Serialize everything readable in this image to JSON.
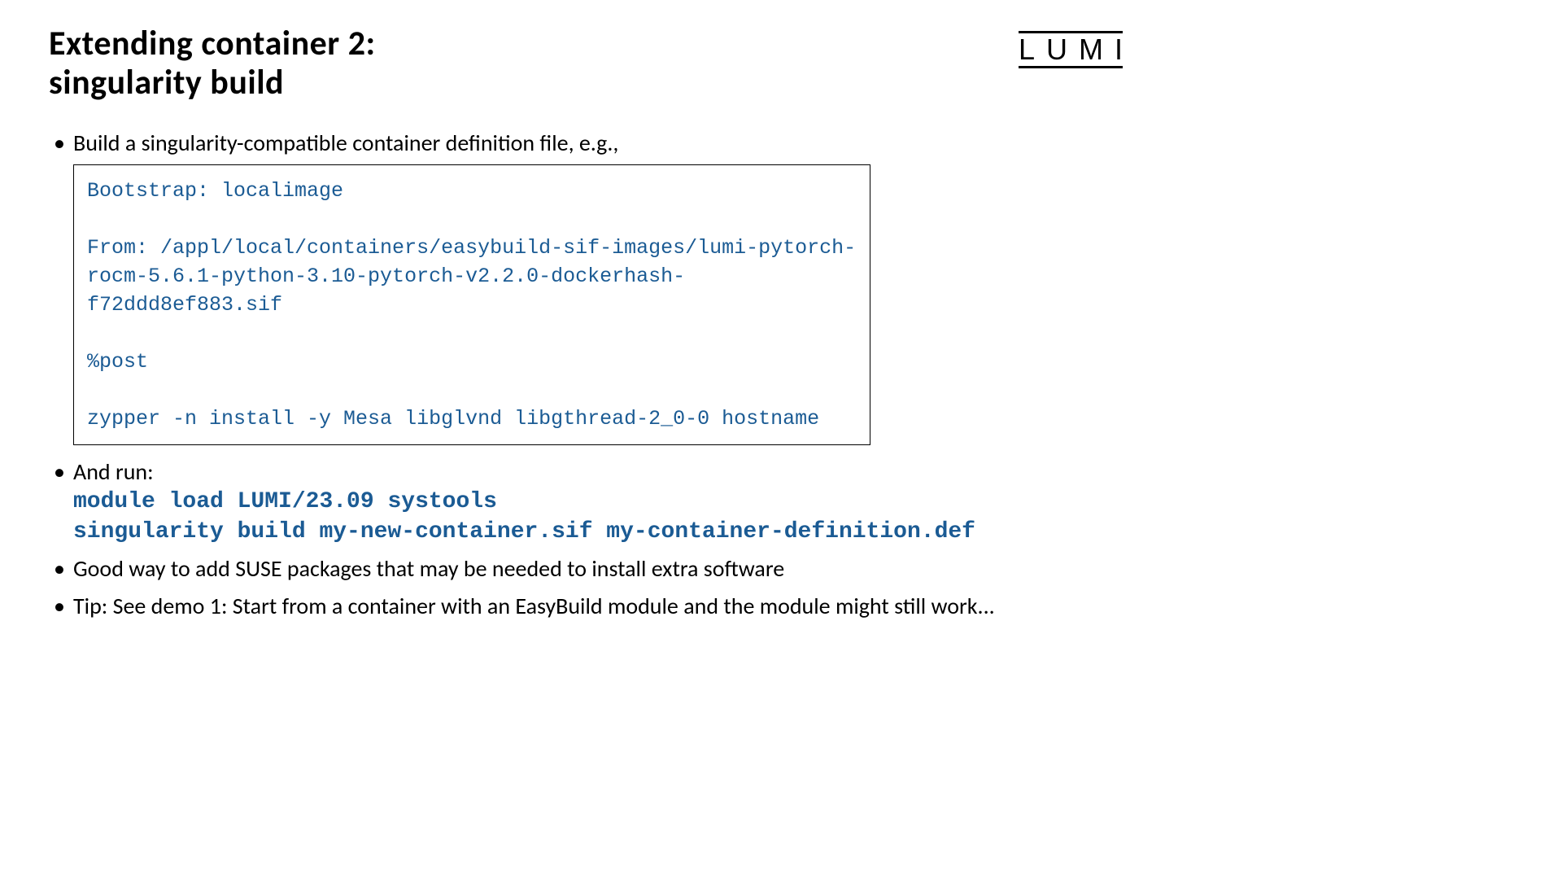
{
  "header": {
    "title_line1": "Extending container 2:",
    "title_line2": "singularity build",
    "logo": "LUMI"
  },
  "bullets": {
    "b1": "Build a singularity-compatible container definition file, e.g.,",
    "code": "Bootstrap: localimage\n\nFrom: /appl/local/containers/easybuild-sif-images/lumi-pytorch-rocm-5.6.1-python-3.10-pytorch-v2.2.0-dockerhash-f72ddd8ef883.sif\n\n%post\n\nzypper -n install -y Mesa libglvnd libgthread-2_0-0 hostname",
    "b2_text": "And run:",
    "b2_cmd1": "module load LUMI/23.09 systools",
    "b2_cmd2": "singularity build my-new-container.sif my-container-definition.def",
    "b3": "Good way to add SUSE packages that may be needed to install extra software",
    "b4": "Tip: See demo 1: Start from a container with an EasyBuild module and the module might still work..."
  }
}
